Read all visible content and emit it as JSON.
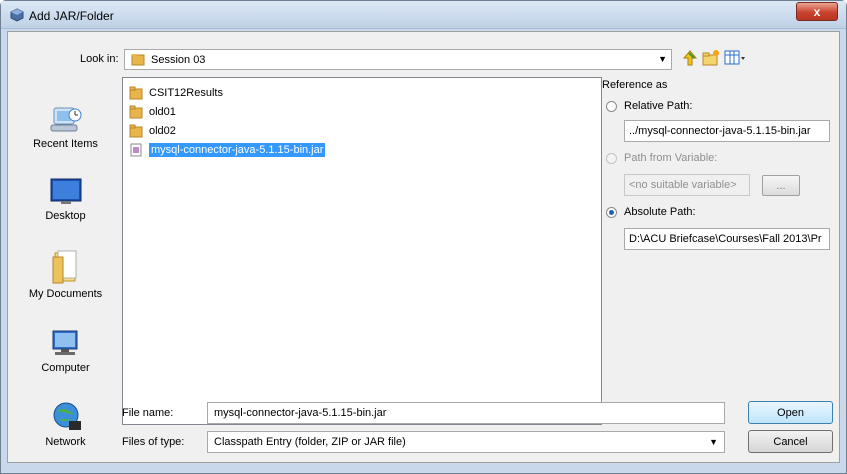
{
  "window": {
    "title": "Add JAR/Folder",
    "close_label": "x"
  },
  "lookin": {
    "label": "Look in:",
    "value": "Session 03"
  },
  "places": [
    {
      "label": "Recent Items",
      "icon": "recent-items-icon"
    },
    {
      "label": "Desktop",
      "icon": "desktop-icon"
    },
    {
      "label": "My Documents",
      "icon": "my-documents-icon"
    },
    {
      "label": "Computer",
      "icon": "computer-icon"
    },
    {
      "label": "Network",
      "icon": "network-icon"
    }
  ],
  "files": [
    {
      "name": "CSIT12Results",
      "type": "folder"
    },
    {
      "name": "old01",
      "type": "folder"
    },
    {
      "name": "old02",
      "type": "folder"
    },
    {
      "name": "mysql-connector-java-5.1.15-bin.jar",
      "type": "jar",
      "selected": true
    }
  ],
  "reference": {
    "title": "Reference as",
    "relative_label": "Relative Path:",
    "relative_value": "../mysql-connector-java-5.1.15-bin.jar",
    "variable_label": "Path from Variable:",
    "variable_value": "<no suitable variable>",
    "variable_button": "...",
    "absolute_label": "Absolute Path:",
    "absolute_value": "D:\\ACU Briefcase\\Courses\\Fall 2013\\Pr",
    "selected": "absolute"
  },
  "filename": {
    "label": "File name:",
    "value": "mysql-connector-java-5.1.15-bin.jar"
  },
  "filetype": {
    "label": "Files of type:",
    "value": "Classpath Entry (folder, ZIP or JAR file)"
  },
  "buttons": {
    "open": "Open",
    "cancel": "Cancel"
  },
  "colors": {
    "selection": "#3399ff",
    "folder": "#e8b54a",
    "title_bar": "#bfd1e7"
  }
}
